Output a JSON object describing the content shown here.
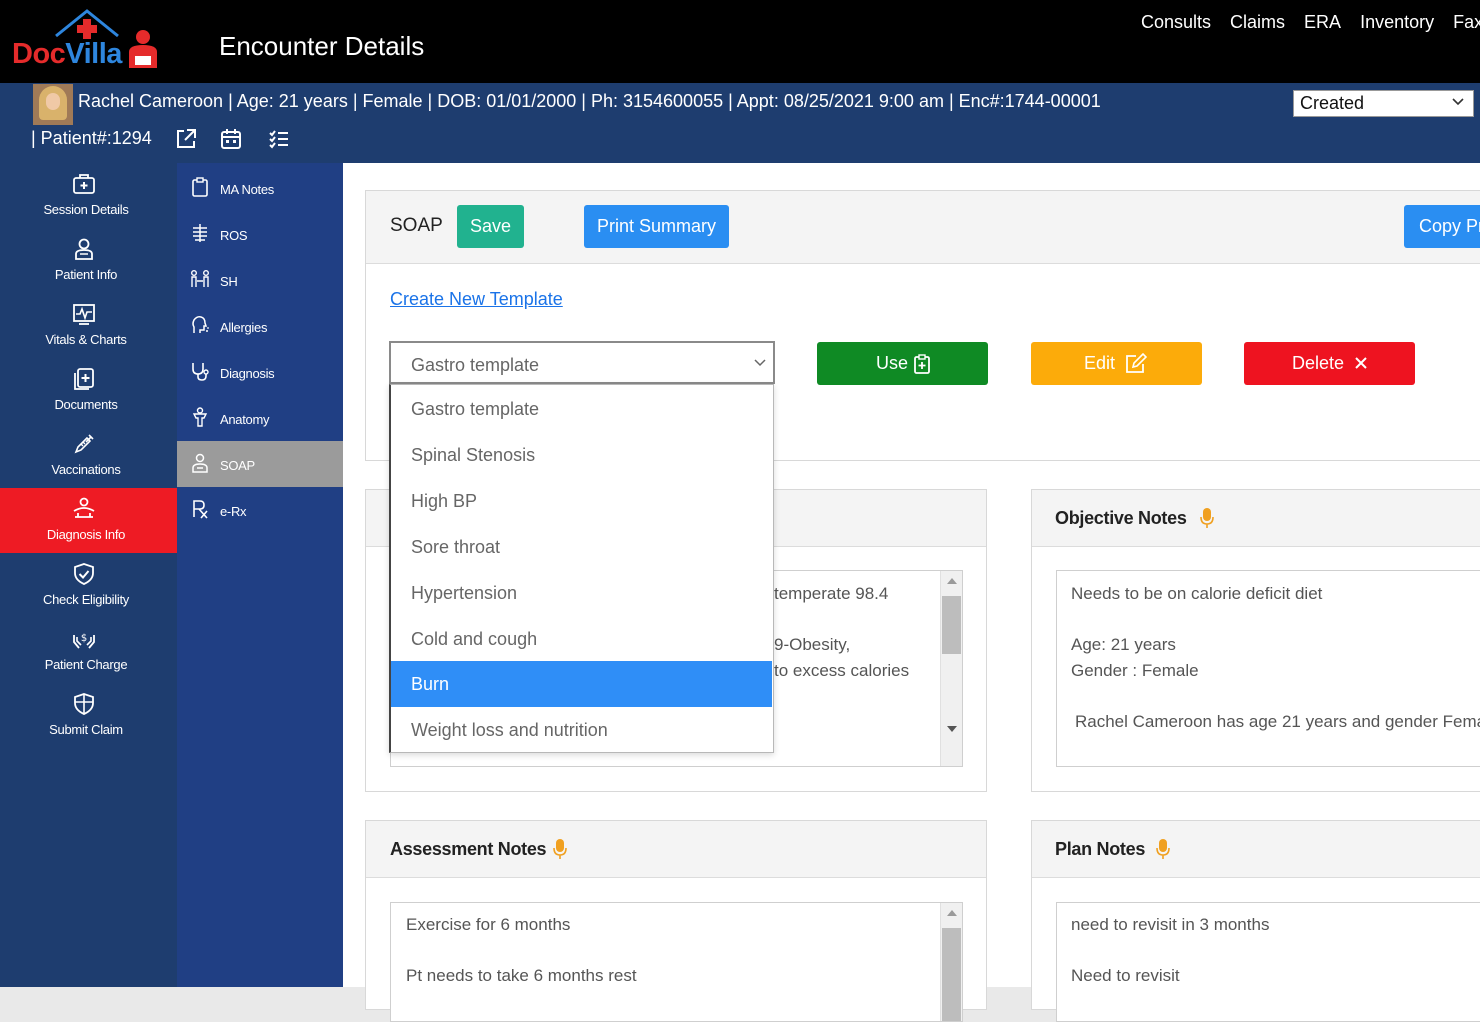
{
  "header": {
    "logo_doc": "Doc",
    "logo_villa": "Villa",
    "title": "Encounter Details",
    "nav": [
      "Consults",
      "Claims",
      "ERA",
      "Inventory",
      "Fax"
    ]
  },
  "patient": {
    "line1": "Rachel Cameroon | Age: 21 years | Female | DOB: 01/01/2000 | Ph: 3154600055 | Appt: 08/25/2021 9:00 am | Enc#:1744-00001",
    "line2": "| Patient#:1294",
    "status": "Created"
  },
  "sidebar": {
    "items": [
      {
        "label": "Session Details",
        "icon": "medical-kit-icon"
      },
      {
        "label": "Patient Info",
        "icon": "patient-icon"
      },
      {
        "label": "Vitals & Charts",
        "icon": "vitals-icon"
      },
      {
        "label": "Documents",
        "icon": "documents-icon"
      },
      {
        "label": "Vaccinations",
        "icon": "syringe-icon"
      },
      {
        "label": "Diagnosis Info",
        "icon": "diagnosis-icon"
      },
      {
        "label": "Check Eligibility",
        "icon": "shield-check-icon"
      },
      {
        "label": "Patient Charge",
        "icon": "hands-charge-icon"
      },
      {
        "label": "Submit Claim",
        "icon": "shield-plus-icon"
      }
    ],
    "active_index": 5
  },
  "subnav": {
    "items": [
      {
        "label": "MA Notes",
        "icon": "clipboard-icon"
      },
      {
        "label": "ROS",
        "icon": "ros-icon"
      },
      {
        "label": "SH",
        "icon": "social-history-icon"
      },
      {
        "label": "Allergies",
        "icon": "allergies-icon"
      },
      {
        "label": "Diagnosis",
        "icon": "stethoscope-icon"
      },
      {
        "label": "Anatomy",
        "icon": "anatomy-icon"
      },
      {
        "label": "SOAP",
        "icon": "soap-icon"
      },
      {
        "label": "e-Rx",
        "icon": "rx-icon"
      }
    ],
    "active_index": 6
  },
  "soap": {
    "title": "SOAP",
    "save_label": "Save",
    "print_label": "Print Summary",
    "copy_label": "Copy Pr",
    "create_template_link": "Create New Template",
    "template_selected": "Gastro template",
    "use_label": "Use",
    "edit_label": "Edit",
    "delete_label": "Delete",
    "templates": [
      "Gastro template",
      "Spinal Stenosis",
      "High BP",
      "Sore throat",
      "Hypertension",
      "Cold and cough",
      "Burn",
      "Weight loss and nutrition"
    ],
    "highlighted_template": "Burn"
  },
  "subjective": {
    "lines": [
      "temperate  98.4",
      "9-Obesity,",
      " to excess calories"
    ]
  },
  "objective": {
    "title": "Objective Notes",
    "lines": [
      "Needs to be on calorie deficit diet",
      "Age:  21 years",
      "Gender :  Female",
      "Rachel  Cameroon has age   21 years and gender  Fema"
    ]
  },
  "assessment": {
    "title": "Assessment Notes",
    "lines": [
      "Exercise for 6 months",
      "Pt needs to take 6 months rest"
    ]
  },
  "plan": {
    "title": "Plan Notes",
    "lines": [
      "need to revisit in 3 months",
      "Need to revisit"
    ]
  },
  "colors": {
    "topbar": "#000000",
    "patientbar": "#1e3d6f",
    "sidebar_active": "#ee1b24",
    "save": "#21b28f",
    "print": "#2a8ef2",
    "use": "#0f8a24",
    "edit": "#fcab0a",
    "delete": "#ee1320",
    "mic": "#f0a020",
    "dropdown_highlight": "#2f8ef7"
  }
}
